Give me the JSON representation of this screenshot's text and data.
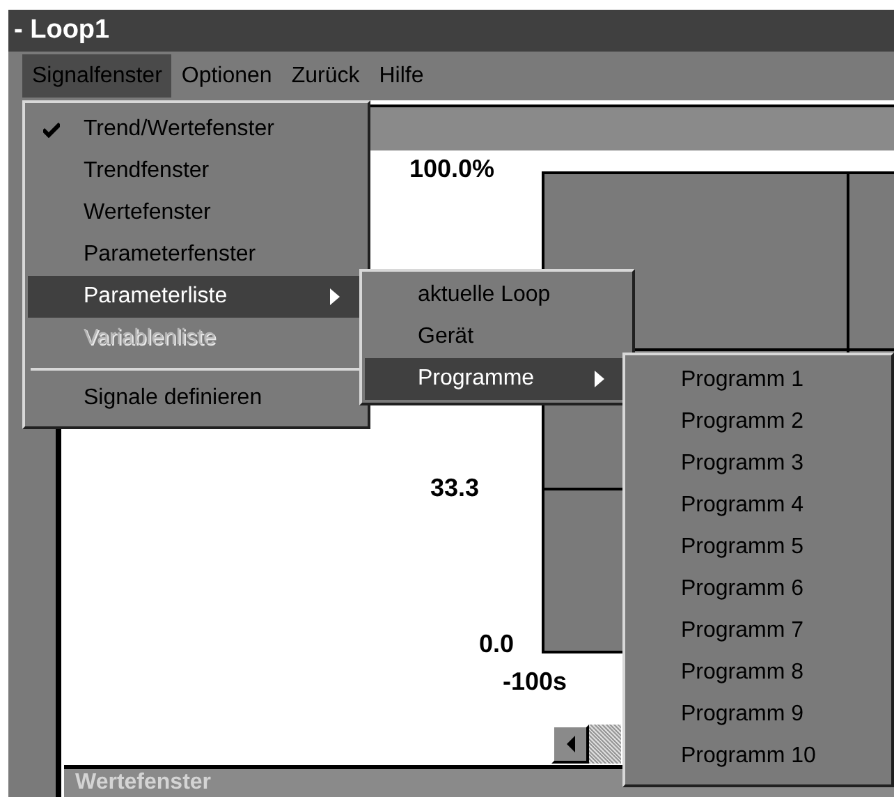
{
  "window": {
    "title": "- Loop1"
  },
  "menubar": [
    {
      "label": "Signalfenster",
      "selected": true
    },
    {
      "label": "Optionen",
      "selected": false
    },
    {
      "label": "Zurück",
      "selected": false
    },
    {
      "label": "Hilfe",
      "selected": false
    }
  ],
  "menu": [
    {
      "kind": "item",
      "label": "Trend/Wertefenster",
      "checked": true,
      "selected": false,
      "disabled": false,
      "submenu": false
    },
    {
      "kind": "item",
      "label": "Trendfenster",
      "checked": false,
      "selected": false,
      "disabled": false,
      "submenu": false
    },
    {
      "kind": "item",
      "label": "Wertefenster",
      "checked": false,
      "selected": false,
      "disabled": false,
      "submenu": false
    },
    {
      "kind": "item",
      "label": "Parameterfenster",
      "checked": false,
      "selected": false,
      "disabled": false,
      "submenu": false
    },
    {
      "kind": "item",
      "label": "Parameterliste",
      "checked": false,
      "selected": true,
      "disabled": false,
      "submenu": true
    },
    {
      "kind": "item",
      "label": "Variablenliste",
      "checked": false,
      "selected": false,
      "disabled": true,
      "submenu": false
    },
    {
      "kind": "separator"
    },
    {
      "kind": "item",
      "label": "Signale definieren",
      "checked": false,
      "selected": false,
      "disabled": false,
      "submenu": false
    }
  ],
  "submenu": [
    {
      "label": "aktuelle Loop",
      "selected": false,
      "submenu": false
    },
    {
      "label": "Gerät",
      "selected": false,
      "submenu": false
    },
    {
      "label": "Programme",
      "selected": true,
      "submenu": true
    }
  ],
  "programs_menu": [
    {
      "label": "Programm 1",
      "selected": false
    },
    {
      "label": "Programm 2",
      "selected": false
    },
    {
      "label": "Programm 3",
      "selected": false
    },
    {
      "label": "Programm 4",
      "selected": false
    },
    {
      "label": "Programm 5",
      "selected": false
    },
    {
      "label": "Programm 6",
      "selected": false
    },
    {
      "label": "Programm 7",
      "selected": false
    },
    {
      "label": "Programm 8",
      "selected": false
    },
    {
      "label": "Programm 9",
      "selected": false
    },
    {
      "label": "Programm 10",
      "selected": false
    }
  ],
  "trend": {
    "y_max": "100.0%",
    "y_mid": "33.3",
    "y_min": "0.0",
    "x_start": "-100s"
  },
  "values_window": {
    "title": "Wertefenster"
  }
}
